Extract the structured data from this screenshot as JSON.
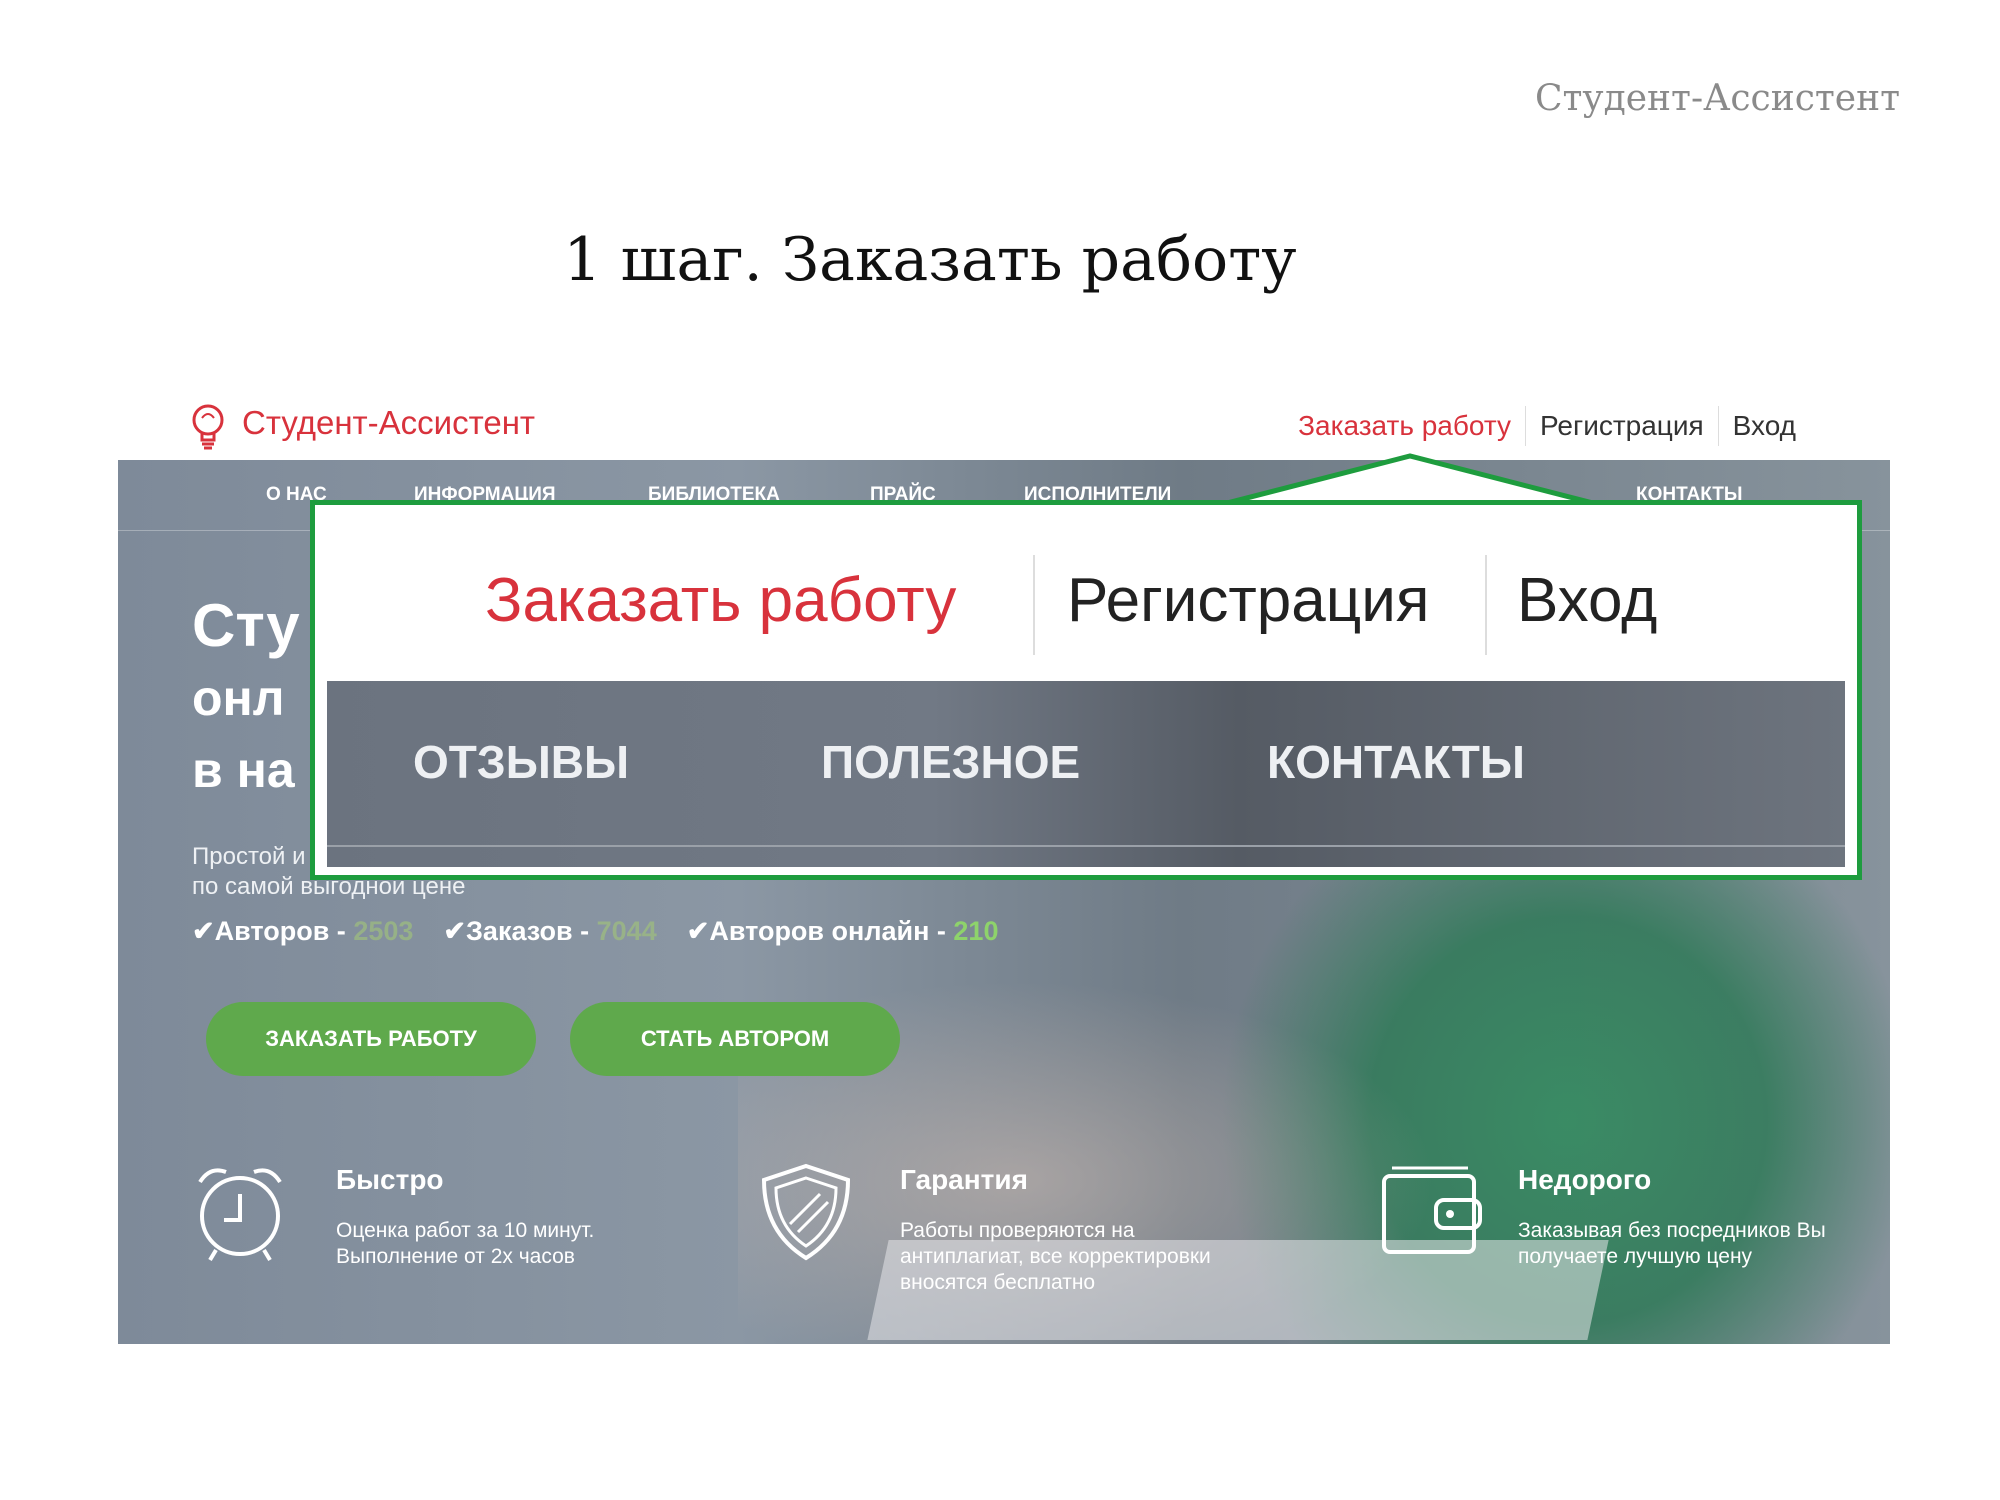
{
  "slide": {
    "brand": "Студент-Ассистент",
    "title": "1 шаг. Заказать работу"
  },
  "site": {
    "logo_text": "Студент-Ассистент",
    "top_links": [
      "Заказать работу",
      "Регистрация",
      "Вход"
    ],
    "nav": [
      "О НАС",
      "ИНФОРМАЦИЯ",
      "БИБЛИОТЕКА",
      "ПРАЙС",
      "ИСПОЛНИТЕЛИ",
      "КОНТАКТЫ"
    ],
    "hero_title": [
      "Сту",
      "онл",
      "в на"
    ],
    "hero_sub": [
      "Простой и",
      "по самой выгодной цене"
    ],
    "stats": [
      {
        "label": "Авторов - ",
        "value": "2503"
      },
      {
        "label": "Заказов - ",
        "value": "7044"
      },
      {
        "label": "Авторов онлайн - ",
        "value": "210"
      }
    ],
    "buttons": {
      "order": "ЗАКАЗАТЬ РАБОТУ",
      "author": "СТАТЬ АВТОРОМ"
    },
    "features": [
      {
        "title": "Быстро",
        "text": "Оценка работ за 10 минут. Выполнение от 2х часов",
        "icon": "alarm-clock-icon"
      },
      {
        "title": "Гарантия",
        "text": "Работы проверяются на антиплагиат, все корректировки вносятся бесплатно",
        "icon": "shield-icon"
      },
      {
        "title": "Недорого",
        "text": "Заказывая без посредников Вы получаете лучшую цену",
        "icon": "wallet-icon"
      }
    ]
  },
  "callout": {
    "links": [
      "Заказать работу",
      "Регистрация",
      "Вход"
    ],
    "nav": [
      "ОТЗЫВЫ",
      "ПОЛЕЗНОЕ",
      "КОНТАКТЫ"
    ]
  },
  "colors": {
    "accent_red": "#d8323c",
    "button_green": "#5fa94c",
    "callout_border": "#1e9c3e",
    "stat_green": "#8ed36b"
  }
}
